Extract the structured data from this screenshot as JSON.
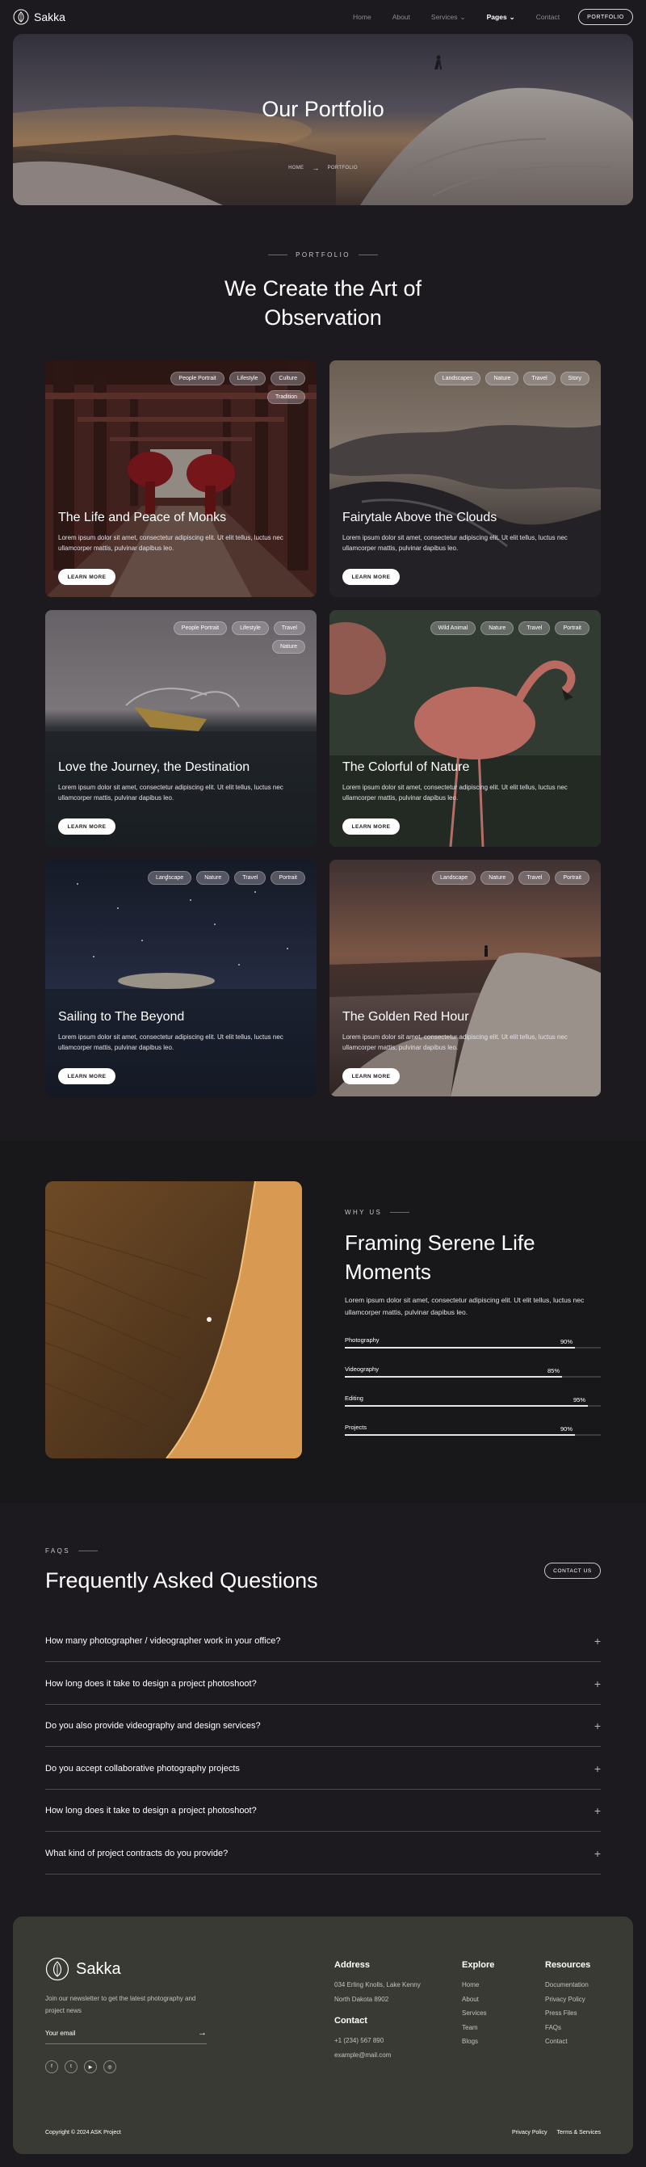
{
  "nav": {
    "brand": "Sakka",
    "links": [
      {
        "label": "Home"
      },
      {
        "label": "About"
      },
      {
        "label": "Services",
        "dropdown": true
      },
      {
        "label": "Pages",
        "dropdown": true,
        "active": true
      },
      {
        "label": "Contact"
      }
    ],
    "cta": "PORTFOLIO"
  },
  "hero": {
    "title": "Our Portfolio",
    "breadcrumb_home": "HOME",
    "breadcrumb_current": "PORTFOLIO"
  },
  "portfolio": {
    "eyebrow": "PORTFOLIO",
    "title_line1": "We Create the Art of",
    "title_line2": "Observation",
    "learn_more": "LEARN MORE",
    "cards": [
      {
        "title": "The Life and Peace of Monks",
        "tags": [
          "People Portrait",
          "Lifestyle",
          "Culture",
          "Tradition"
        ],
        "desc": "Lorem ipsum dolor sit amet, consectetur adipiscing elit. Ut elit tellus, luctus nec ullamcorper mattis, pulvinar dapibus leo."
      },
      {
        "title": "Fairytale Above the Clouds",
        "tags": [
          "Landscapes",
          "Nature",
          "Travel",
          "Story"
        ],
        "desc": "Lorem ipsum dolor sit amet, consectetur adipiscing elit. Ut elit tellus, luctus nec ullamcorper mattis, pulvinar dapibus leo."
      },
      {
        "title": "Love the Journey, the Destination",
        "tags": [
          "People Portrait",
          "Lifestyle",
          "Travel",
          "Nature"
        ],
        "desc": "Lorem ipsum dolor sit amet, consectetur adipiscing elit. Ut elit tellus, luctus nec ullamcorper mattis, pulvinar dapibus leo."
      },
      {
        "title": "The Colorful of Nature",
        "tags": [
          "Wild Animal",
          "Nature",
          "Travel",
          "Portrait"
        ],
        "desc": "Lorem ipsum dolor sit amet, consectetur adipiscing elit. Ut elit tellus, luctus nec ullamcorper mattis, pulvinar dapibus leo."
      },
      {
        "title": "Sailing to The Beyond",
        "tags": [
          "Landscape",
          "Nature",
          "Travel",
          "Portrait"
        ],
        "desc": "Lorem ipsum dolor sit amet, consectetur adipiscing elit. Ut elit tellus, luctus nec ullamcorper mattis, pulvinar dapibus leo."
      },
      {
        "title": "The Golden Red Hour",
        "tags": [
          "Landscape",
          "Nature",
          "Travel",
          "Portrait"
        ],
        "desc": "Lorem ipsum dolor sit amet, consectetur adipiscing elit. Ut elit tellus, luctus nec ullamcorper mattis, pulvinar dapibus leo."
      }
    ]
  },
  "why": {
    "eyebrow": "WHY US",
    "title": "Framing Serene Life Moments",
    "desc": "Lorem ipsum dolor sit amet, consectetur adipiscing elit. Ut elit tellus, luctus nec ullamcorper mattis, pulvinar dapibus leo.",
    "skills": [
      {
        "label": "Photography",
        "percent": 90,
        "text": "90%"
      },
      {
        "label": "Videography",
        "percent": 85,
        "text": "85%"
      },
      {
        "label": "Editing",
        "percent": 95,
        "text": "95%"
      },
      {
        "label": "Projects",
        "percent": 90,
        "text": "90%"
      }
    ]
  },
  "faq": {
    "eyebrow": "FAQS",
    "title": "Frequently Asked Questions",
    "cta": "CONTACT US",
    "items": [
      "How many photographer / videographer work in your office?",
      "How long does it take to design a project photoshoot?",
      "Do you also provide videography and design services?",
      "Do you accept collaborative photography projects",
      "How long does it take to design a project photoshoot?",
      "What kind of project contracts do you provide?"
    ]
  },
  "footer": {
    "brand": "Sakka",
    "about": "Join our newsletter to get the latest photography and project news",
    "email_placeholder": "Your email",
    "socials": [
      "facebook-icon",
      "twitter-icon",
      "youtube-icon",
      "instagram-icon"
    ],
    "address_title": "Address",
    "address_line1": "034 Erling Knolls, Lake Kenny",
    "address_line2": "North Dakota 8902",
    "contact_title": "Contact",
    "phone": "+1 (234) 567 890",
    "email": "example@mail.com",
    "explore_title": "Explore",
    "explore": [
      "Home",
      "About",
      "Services",
      "Team",
      "Blogs"
    ],
    "resources_title": "Resources",
    "resources": [
      "Documentation",
      "Privacy Policy",
      "Press Files",
      "FAQs",
      "Contact"
    ],
    "copyright": "Copyright © 2024 ASK Project",
    "privacy": "Privacy Policy",
    "terms": "Terms & Services"
  }
}
